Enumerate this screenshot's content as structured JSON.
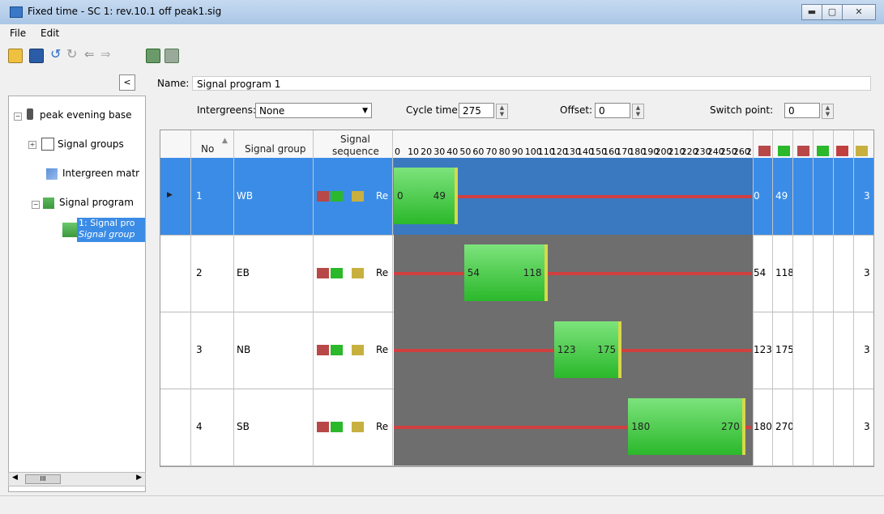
{
  "window": {
    "title": "Fixed time - SC 1: rev.10.1 off peak1.sig"
  },
  "menu": [
    "File",
    "Edit"
  ],
  "tree": {
    "root": "peak evening base",
    "nodes": [
      "Signal groups",
      "Intergreen matr",
      "Signal program"
    ],
    "selected_line1": "1: Signal pro",
    "selected_line2": "Signal group"
  },
  "hscroll_label": "III",
  "form": {
    "name_label": "Name:",
    "name_value": "Signal program 1",
    "intergreens_label": "Intergreens:",
    "intergreens_value": "None",
    "cycle_label": "Cycle time:",
    "cycle_value": "275",
    "offset_label": "Offset:",
    "offset_value": "0",
    "switch_label": "Switch point:",
    "switch_value": "0"
  },
  "table": {
    "headers": {
      "no": "No",
      "group": "Signal group",
      "seq1": "Signal",
      "seq2": "sequence"
    },
    "ruler_labels": [
      "0",
      "10",
      "20",
      "30",
      "40",
      "50",
      "60",
      "70",
      "80",
      "90",
      "100",
      "110",
      "120",
      "130",
      "140",
      "150",
      "160",
      "170",
      "180",
      "190",
      "200",
      "210",
      "220",
      "230",
      "240",
      "250",
      "260",
      "2"
    ],
    "seq_text": "Re",
    "cycle": 275,
    "rows": [
      {
        "no": "1",
        "group": "WB",
        "green_start": 0,
        "green_end": 49,
        "start_label": "0",
        "end_label": "49",
        "col_start": "0",
        "col_end": "49",
        "last": "3",
        "selected": true
      },
      {
        "no": "2",
        "group": "EB",
        "green_start": 54,
        "green_end": 118,
        "start_label": "54",
        "end_label": "118",
        "col_start": "54",
        "col_end": "118",
        "last": "3",
        "selected": false
      },
      {
        "no": "3",
        "group": "NB",
        "green_start": 123,
        "green_end": 175,
        "start_label": "123",
        "end_label": "175",
        "col_start": "123",
        "col_end": "175",
        "last": "3",
        "selected": false
      },
      {
        "no": "4",
        "group": "SB",
        "green_start": 180,
        "green_end": 270,
        "start_label": "180",
        "end_label": "270",
        "col_start": "180",
        "col_end": "270",
        "last": "3",
        "selected": false
      }
    ]
  },
  "colors": {
    "selection": "#3b8ce6",
    "green": "#2bb82b",
    "red": "#d04040",
    "timeline_bg": "#6e6e6e"
  }
}
